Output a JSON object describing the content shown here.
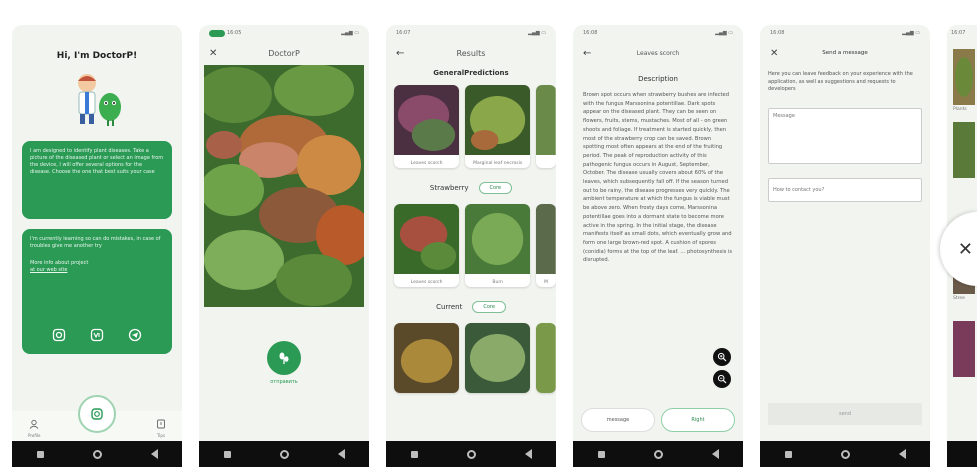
{
  "screens": {
    "home": {
      "greeting": "Hi, I'm DoctorP!",
      "bubble1": "I am designed to identify plant diseases. Take a picture of the diseased plant or select an image from the device, I will offer several options for the disease. Choose the one that best suits your case",
      "bubble2": "I'm currently learning so can do mistakes, in case of troubles give me another try",
      "more_info": "More info about project",
      "web_link": "at our web site",
      "tab_profile": "Profile",
      "tab_tips": "Tips"
    },
    "camera": {
      "status_time": "16:05",
      "title": "DoctorP",
      "send_label": "отправить"
    },
    "results": {
      "status_time": "16:07",
      "title": "Results",
      "general_heading": "GeneralPredictions",
      "tiles_general": [
        "Leaves scorch",
        "Marginal leaf necrosis"
      ],
      "strawberry_heading": "Strawberry",
      "strawberry_pill": "Core",
      "tiles_strawberry": [
        "Leaves scorch",
        "Burn",
        "M"
      ],
      "current_heading": "Current",
      "current_pill": "Core"
    },
    "description": {
      "status_time": "16:08",
      "title": "Leaves scorch",
      "heading": "Description",
      "text": "Brown spot occurs when strawberry bushes are infected with the fungus Marssonina potentillae. Dark spots appear on the diseased plant. They can be seen on flowers, fruits, stems, mustaches. Most of all - on green shoots and foliage. If treatment is started quickly, then most of the strawberry crop can be saved. Brown spotting most often appears at the end of the fruiting period. The peak of reproduction activity of this pathogenic fungus occurs in August, September, October. The disease usually covers about 60% of the leaves, which subsequently fall off. If the season turned out to be rainy, the disease progresses very quickly. The ambient temperature at which the fungus is viable must be above zero. When frosty days come, Marssonina potentillae goes into a dormant state to become more active in the spring. In the initial stage, the disease manifests itself as small dots, which eventually grow and form one large brown-red spot. A cushion of spores (conidia) forms at the top of the leaf. ... photosynthesis is disrupted.",
      "btn_message": "message",
      "btn_right": "Right"
    },
    "feedback": {
      "status_time": "16:08",
      "title": "Send a message",
      "intro": "Here you can leave feedback on your experience with the application, as well as suggestions and requests to developers",
      "message_placeholder": "Message",
      "contact_placeholder": "How to contact you?",
      "send_label": "send"
    },
    "partial": {
      "status_time": "16:07",
      "label1": "Plants",
      "label2": "Stree"
    }
  },
  "colors": {
    "brand_green": "#2a9a55",
    "screen_bg": "#f1f4ef",
    "nav_bg": "#0e0e0e"
  }
}
